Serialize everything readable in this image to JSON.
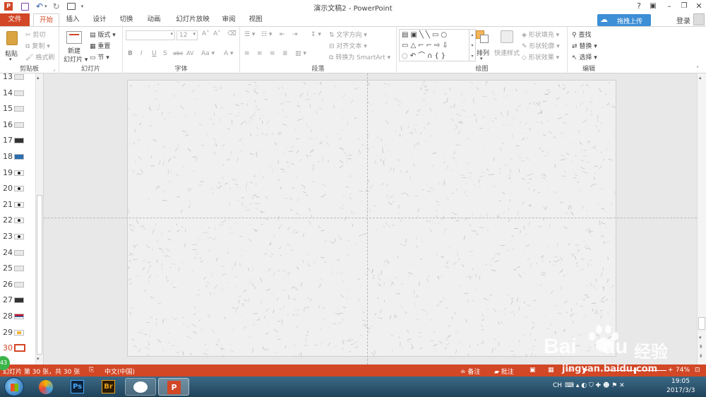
{
  "titlebar": {
    "title": "演示文稿2 - PowerPoint",
    "help": "?",
    "login": "登录",
    "upload_button": "拖拽上传"
  },
  "tabs": [
    "文件",
    "开始",
    "插入",
    "设计",
    "切换",
    "动画",
    "幻灯片放映",
    "审阅",
    "视图"
  ],
  "active_tab": "开始",
  "ribbon": {
    "clipboard": {
      "paste": "粘贴",
      "cut": "剪切",
      "copy": "复制",
      "format_painter": "格式刷",
      "label": "剪贴板"
    },
    "slides": {
      "new_slide": "新建",
      "new_slide_2": "幻灯片",
      "layout": "版式",
      "reset": "重置",
      "section": "节",
      "label": "幻灯片"
    },
    "font": {
      "font_size": "12",
      "label": "字体",
      "bold": "B",
      "italic": "I",
      "underline": "U",
      "shadow": "S",
      "strike": "abc",
      "spacing": "AV",
      "case": "Aa"
    },
    "paragraph": {
      "text_direction": "文字方向",
      "align_text": "对齐文本",
      "convert_smartart": "转换为 SmartArt",
      "label": "段落"
    },
    "drawing": {
      "arrange": "排列",
      "quick_styles": "快速样式",
      "shape_fill": "形状填充",
      "shape_outline": "形状轮廓",
      "shape_effects": "形状效果",
      "label": "绘图"
    },
    "editing": {
      "find": "查找",
      "replace": "替换",
      "select": "选择",
      "label": "编辑"
    }
  },
  "thumbnails": [
    {
      "num": "13"
    },
    {
      "num": "14"
    },
    {
      "num": "15"
    },
    {
      "num": "16"
    },
    {
      "num": "17"
    },
    {
      "num": "18"
    },
    {
      "num": "19"
    },
    {
      "num": "20"
    },
    {
      "num": "21"
    },
    {
      "num": "22"
    },
    {
      "num": "23"
    },
    {
      "num": "24"
    },
    {
      "num": "25"
    },
    {
      "num": "26"
    },
    {
      "num": "27"
    },
    {
      "num": "28"
    },
    {
      "num": "29"
    },
    {
      "num": "30"
    }
  ],
  "selected_slide": "30",
  "status": {
    "slide_info": "幻灯片 第 30 张，共 30 张",
    "language": "中文(中国)",
    "notes": "备注",
    "comments": "批注",
    "zoom": "74%",
    "badge": "43"
  },
  "taskbar": {
    "apps": [
      "start",
      "photoshop-Ps",
      "bridge-Br",
      "wechat",
      "powerpoint-P"
    ],
    "ps_label": "Ps",
    "br_label": "Br",
    "ime": "CH",
    "time": "19:05",
    "date": "2017/3/3"
  },
  "watermark": {
    "brand": "Bai",
    "brand2": "du",
    "cn": "经验",
    "url": "jingyan.baidu.com"
  },
  "colors": {
    "accent": "#d24726",
    "taskbar": "#2b5573",
    "slide_bg": "#f0f0f0"
  }
}
